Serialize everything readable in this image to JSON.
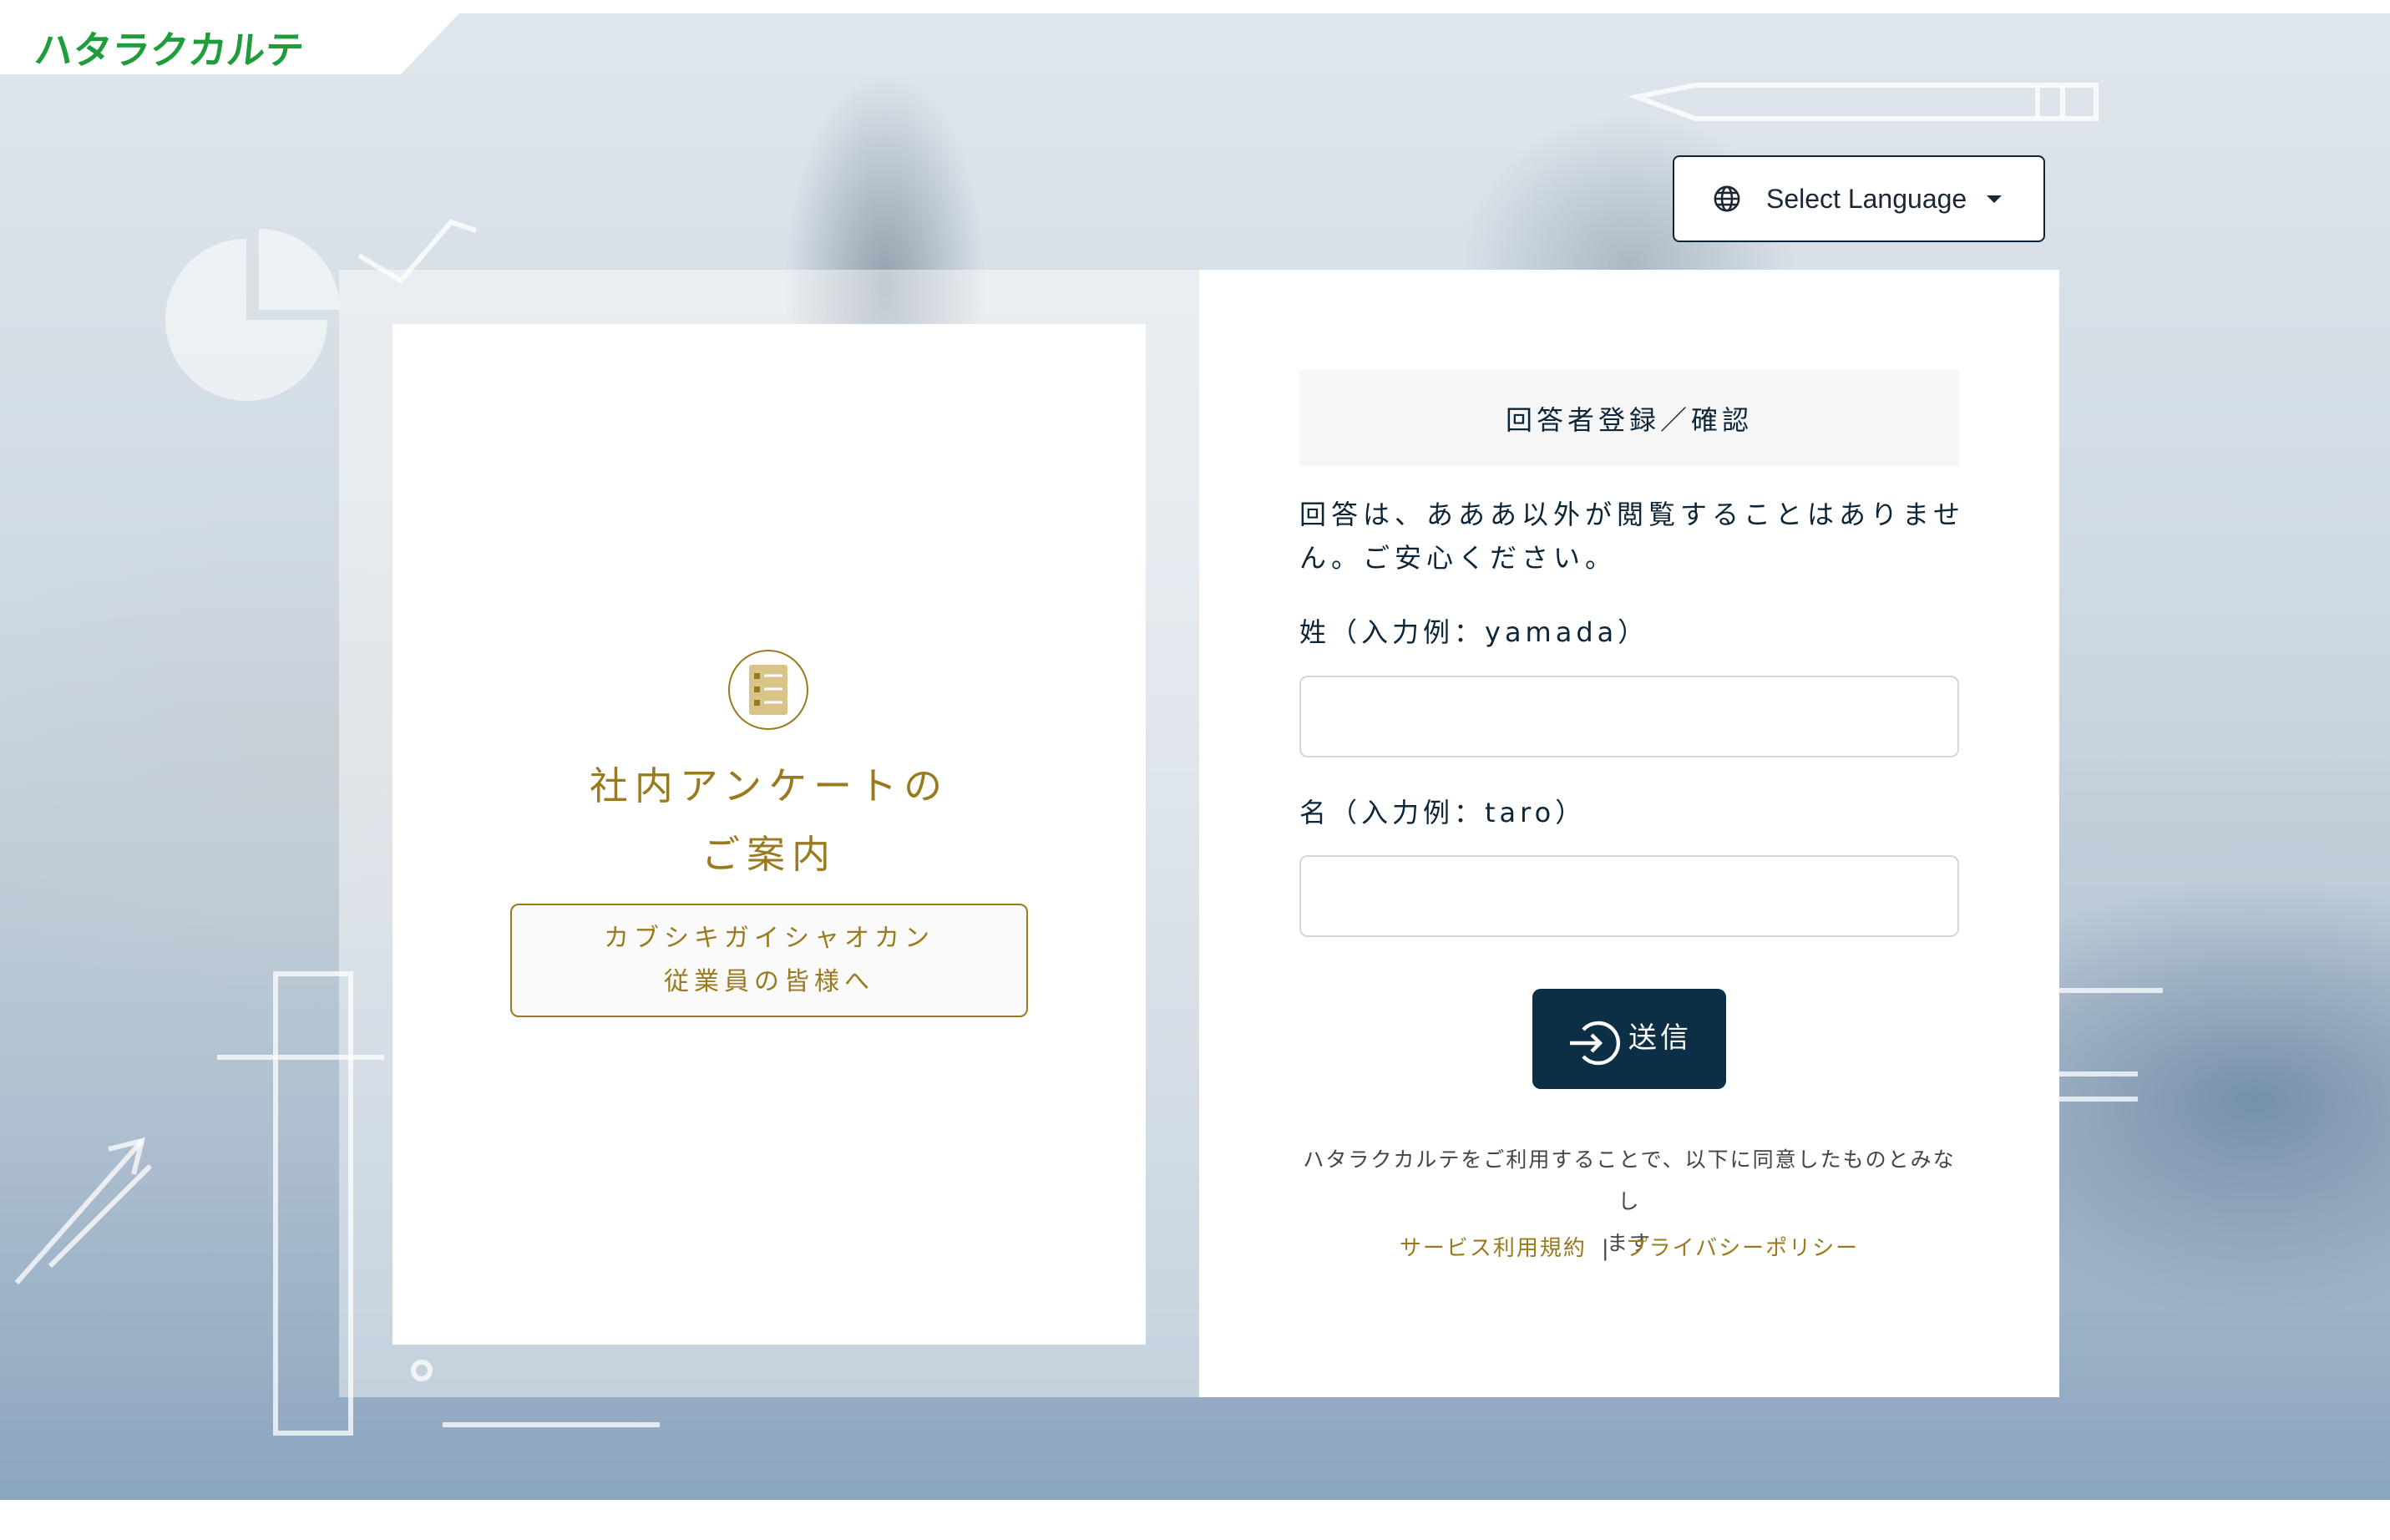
{
  "header": {
    "logo_text": "ハタラクカルテ",
    "logo_color": "#1f9c3c"
  },
  "language": {
    "label": "Select Language",
    "icon": "globe-icon"
  },
  "left_panel": {
    "icon": "document-list-icon",
    "title_line1": "社内アンケートの",
    "title_line2": "ご案内",
    "company_line1": "カブシキガイシャオカン",
    "company_line2": "従業員の皆様へ",
    "accent_color": "#9a7a1e"
  },
  "form": {
    "header": "回答者登録／確認",
    "notice_line1": "回答は、あああ以外が閲覧することはありませ",
    "notice_line2": "ん。ご安心ください。",
    "last_name_label": "姓（入力例：yamada）",
    "last_name_value": "",
    "first_name_label": "名（入力例：taro）",
    "first_name_value": "",
    "submit_label": "送信",
    "submit_icon": "sign-in-icon",
    "button_color": "#0c2f46"
  },
  "footer": {
    "agree_line1": "ハタラクカルテをご利用することで、以下に同意したものとみなし",
    "agree_line2": "ます",
    "terms_link": "サービス利用規約",
    "separator": "|",
    "privacy_link": "プライバシーポリシー"
  }
}
